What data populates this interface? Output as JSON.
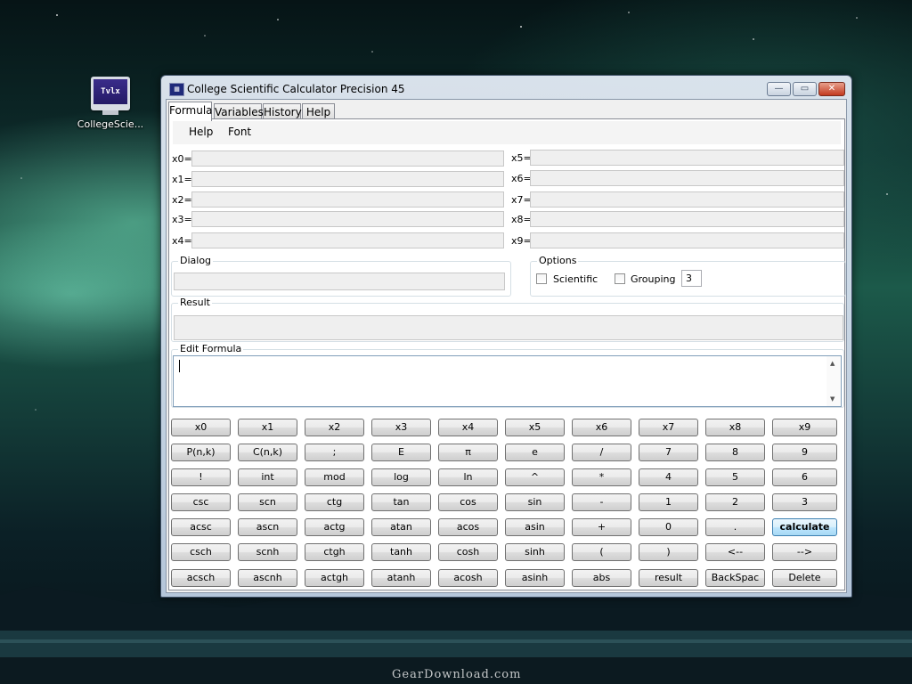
{
  "desktop": {
    "icon": {
      "label": "CollegeScie...",
      "icon": "calculator-monitor-icon",
      "glyph": "Tvlx"
    },
    "watermark": "GearDownload.com"
  },
  "window": {
    "title": "College Scientific Calculator Precision 45",
    "controls": {
      "minimize": "—",
      "maximize": "▭",
      "close": "✕"
    },
    "tabs": [
      "Formula",
      "Variables",
      "History",
      "Help"
    ],
    "active_tab": "Formula",
    "menu": [
      "Help",
      "Font"
    ],
    "variables_left": [
      "x0=",
      "x1=",
      "x2=",
      "x3=",
      "x4="
    ],
    "variables_right": [
      "x5=",
      "x6=",
      "x7=",
      "x8=",
      "x9="
    ],
    "dialog": {
      "title": "Dialog",
      "value": ""
    },
    "options": {
      "title": "Options",
      "scientific_label": "Scientific",
      "grouping_label": "Grouping",
      "grouping_value": "3",
      "scientific_checked": false,
      "grouping_checked": false
    },
    "result": {
      "title": "Result",
      "value": ""
    },
    "edit_formula": {
      "title": "Edit Formula",
      "value": ""
    }
  },
  "keypad": {
    "rows": [
      [
        "x0",
        "x1",
        "x2",
        "x3",
        "x4",
        "x5",
        "x6",
        "x7",
        "x8",
        "x9"
      ],
      [
        "P(n,k)",
        "C(n,k)",
        ";",
        "E",
        "π",
        "e",
        "/",
        "7",
        "8",
        "9"
      ],
      [
        "!",
        "int",
        "mod",
        "log",
        "ln",
        "^",
        "*",
        "4",
        "5",
        "6"
      ],
      [
        "csc",
        "scn",
        "ctg",
        "tan",
        "cos",
        "sin",
        "-",
        "1",
        "2",
        "3"
      ],
      [
        "acsc",
        "ascn",
        "actg",
        "atan",
        "acos",
        "asin",
        "+",
        "0",
        ".",
        "calculate"
      ],
      [
        "csch",
        "scnh",
        "ctgh",
        "tanh",
        "cosh",
        "sinh",
        "(",
        ")",
        "<--",
        "-->"
      ],
      [
        "acsch",
        "ascnh",
        "actgh",
        "atanh",
        "acosh",
        "asinh",
        "abs",
        "result",
        "BackSpac",
        "Delete"
      ]
    ]
  },
  "colors": {
    "primary_button": "#bee6fd",
    "window_frame": "#bccde1",
    "field_disabled": "#efefef"
  }
}
